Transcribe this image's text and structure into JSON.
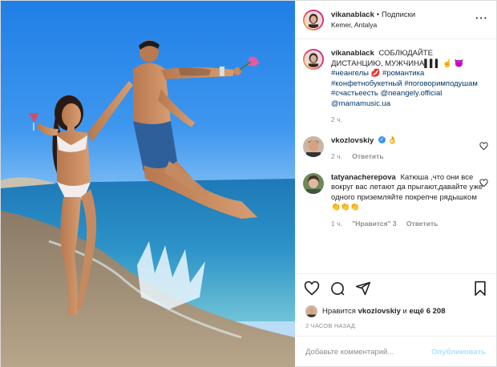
{
  "post": {
    "author": "vikanablack",
    "follow_label": "Подписки",
    "location": "Kemer, Antalya",
    "more_icon": "more-horizontal-icon",
    "caption": {
      "username": "vikanablack",
      "text": "СОБЛЮДАЙТЕ ДИСТАНЦИЮ, МУЖЧИНА▌▌▌ ☝ 😈",
      "hashtags": "#неангелы 💋 #романтика #конфетнобукетный #поговоримподушам #счастьеесть @neangely.official @mamamusic.ua",
      "time": "2 ч."
    }
  },
  "comments": [
    {
      "username": "vkozlovskiy",
      "verified": true,
      "text": "👌",
      "time": "2 ч.",
      "reply_label": "Ответить"
    },
    {
      "username": "tatyanacherepova",
      "text": "Катюша ,что они все вокруг вас летают да прыгают,давайте уже одного приземляйте покрепче рядышком👏👏👏",
      "time": "1 ч.",
      "likes": "\"Нравится\" 3",
      "reply_label": "Ответить"
    }
  ],
  "actions": {
    "like_icon": "heart-icon",
    "comment_icon": "comment-icon",
    "share_icon": "share-icon",
    "save_icon": "bookmark-icon"
  },
  "likes": {
    "prefix": "Нравится",
    "user": "vkozlovskiy",
    "suffix": "и",
    "others": "ещё 6 208"
  },
  "timestamp": "2 ЧАСОВ НАЗАД",
  "add_comment": {
    "placeholder": "Добавьте комментарий...",
    "post_label": "Опубликовать"
  },
  "colors": {
    "link": "#00376b",
    "verified": "#3897f0",
    "post_disabled": "#b2dffc",
    "muted": "#8e8e8e"
  }
}
